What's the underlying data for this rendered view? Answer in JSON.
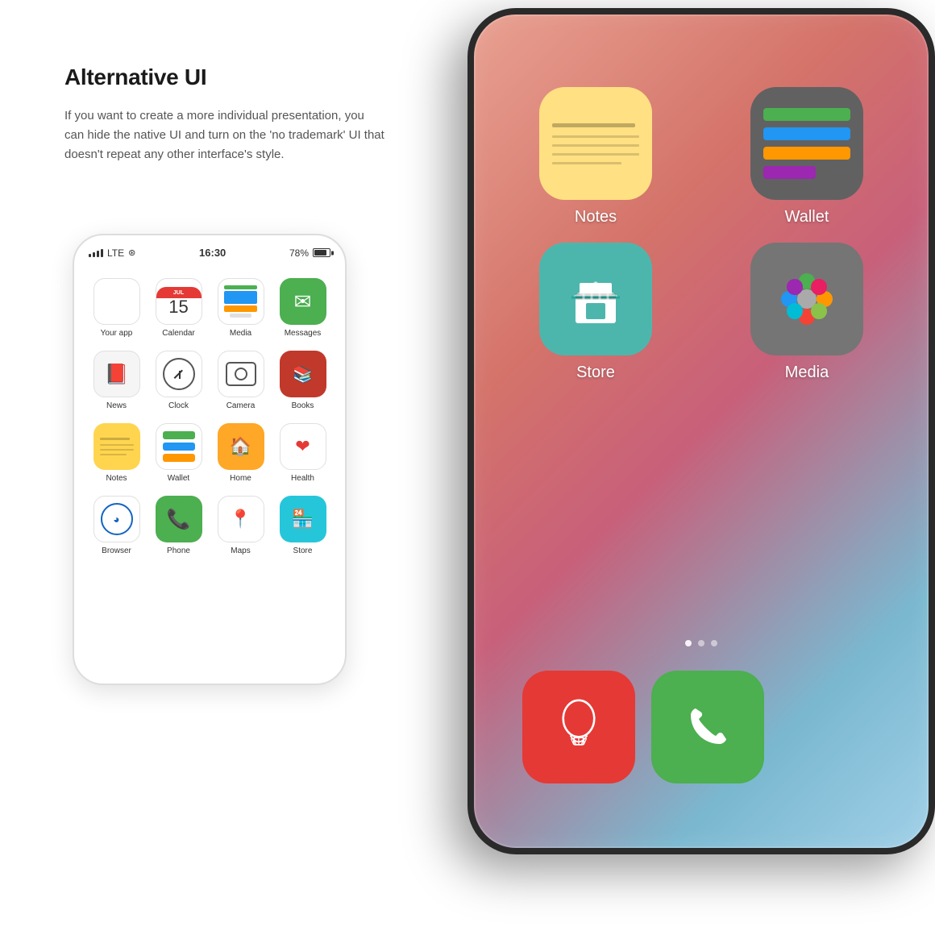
{
  "heading": {
    "title": "Alternative UI",
    "description": "If you want to create a more individual presentation, you can hide the native UI and turn on the 'no trademark' UI that doesn't repeat any other interface's style."
  },
  "phone_small": {
    "status": {
      "signal": "LTE",
      "wifi": true,
      "time": "16:30",
      "battery": "78%"
    },
    "apps": [
      {
        "id": "your-app",
        "label": "Your app",
        "row": 1
      },
      {
        "id": "calendar",
        "label": "Calendar",
        "row": 1
      },
      {
        "id": "media",
        "label": "Media",
        "row": 1
      },
      {
        "id": "messages",
        "label": "Messages",
        "row": 1
      },
      {
        "id": "news",
        "label": "News",
        "row": 2
      },
      {
        "id": "clock",
        "label": "Clock",
        "row": 2
      },
      {
        "id": "camera",
        "label": "Camera",
        "row": 2
      },
      {
        "id": "books",
        "label": "Books",
        "row": 2
      },
      {
        "id": "notes",
        "label": "Notes",
        "row": 3
      },
      {
        "id": "wallet",
        "label": "Wallet",
        "row": 3
      },
      {
        "id": "home",
        "label": "Home",
        "row": 3
      },
      {
        "id": "health",
        "label": "Health",
        "row": 3
      },
      {
        "id": "browser",
        "label": "Browser",
        "row": 4
      },
      {
        "id": "phone",
        "label": "Phone",
        "row": 4
      },
      {
        "id": "maps",
        "label": "Maps",
        "row": 4
      },
      {
        "id": "store",
        "label": "Store",
        "row": 4
      }
    ]
  },
  "phone_large": {
    "apps_visible": [
      {
        "id": "notes",
        "label": "Notes"
      },
      {
        "id": "wallet",
        "label": "Wallet"
      },
      {
        "id": "store",
        "label": "Store"
      },
      {
        "id": "media",
        "label": "Media"
      }
    ],
    "dock": [
      {
        "id": "balloon",
        "label": ""
      },
      {
        "id": "phone",
        "label": ""
      }
    ]
  }
}
